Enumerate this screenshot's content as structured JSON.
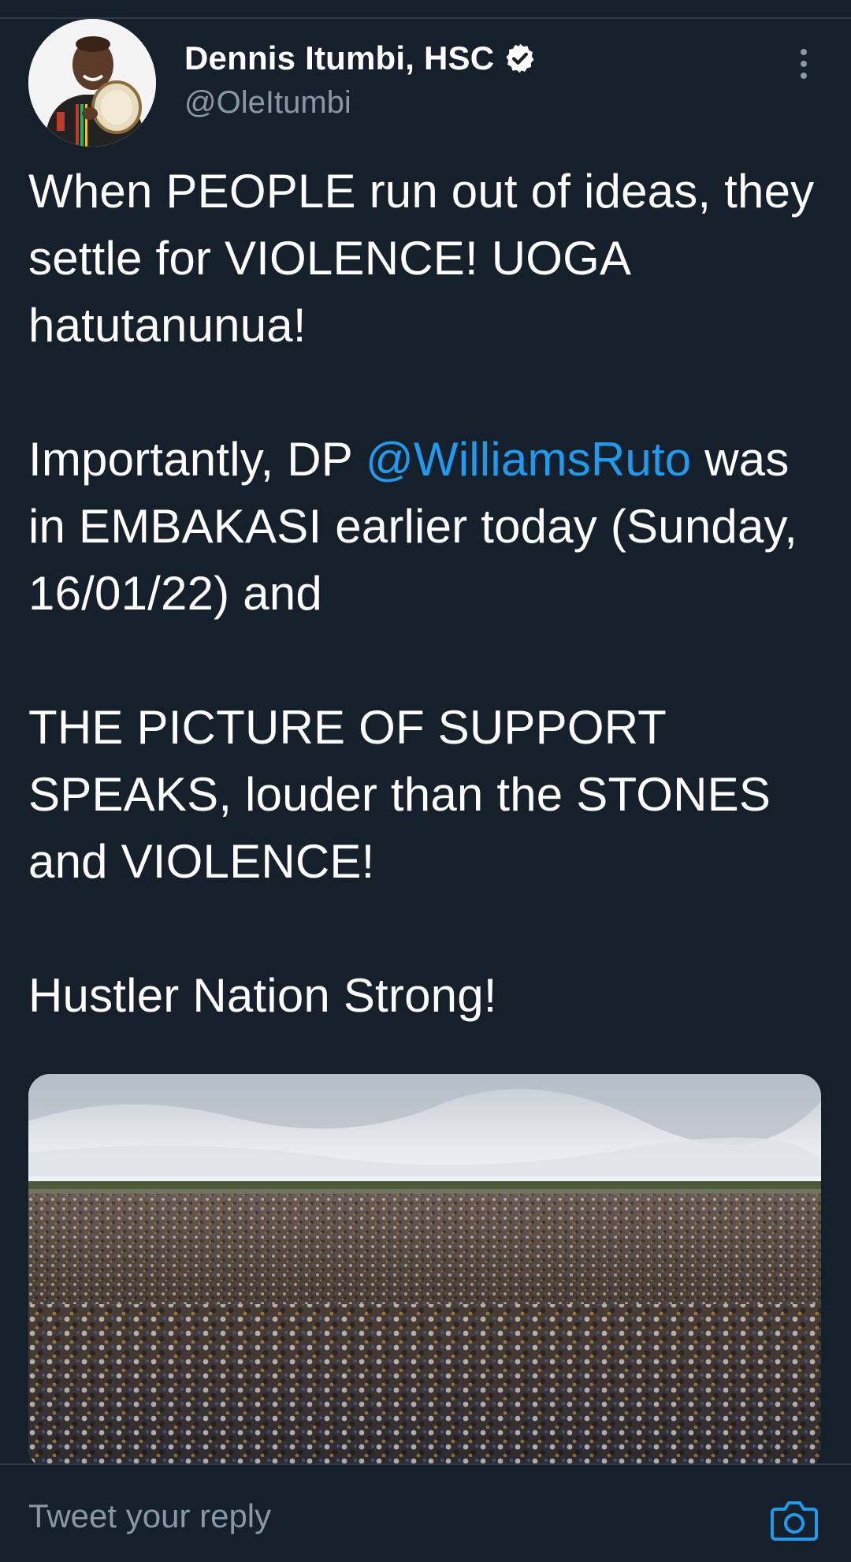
{
  "tweet": {
    "author": {
      "display_name": "Dennis Itumbi, HSC",
      "handle": "@OleItumbi",
      "verified": true,
      "avatar_icon": "user-avatar"
    },
    "menu_icon": "more-vertical-icon",
    "text": {
      "p1": "When PEOPLE run out of ideas, they settle for VIOLENCE! UOGA hatutanunua!",
      "p2_before": "Importantly, DP ",
      "p2_mention": "@WilliamsRuto",
      "p2_after": " was in EMBAKASI earlier today (Sunday, 16/01/22) and",
      "p3": "THE PICTURE OF SUPPORT SPEAKS, louder than the STONES and VIOLENCE!",
      "p4": "Hustler Nation Strong!"
    },
    "media": {
      "kind": "photo",
      "icon": "crowd-photo"
    }
  },
  "reply": {
    "placeholder": "Tweet your reply",
    "camera_icon": "camera-icon"
  },
  "colors": {
    "background": "#15202b",
    "text": "#ffffff",
    "secondary_text": "#8899a6",
    "accent": "#1d9bf0",
    "divider": "#2f3b47"
  }
}
